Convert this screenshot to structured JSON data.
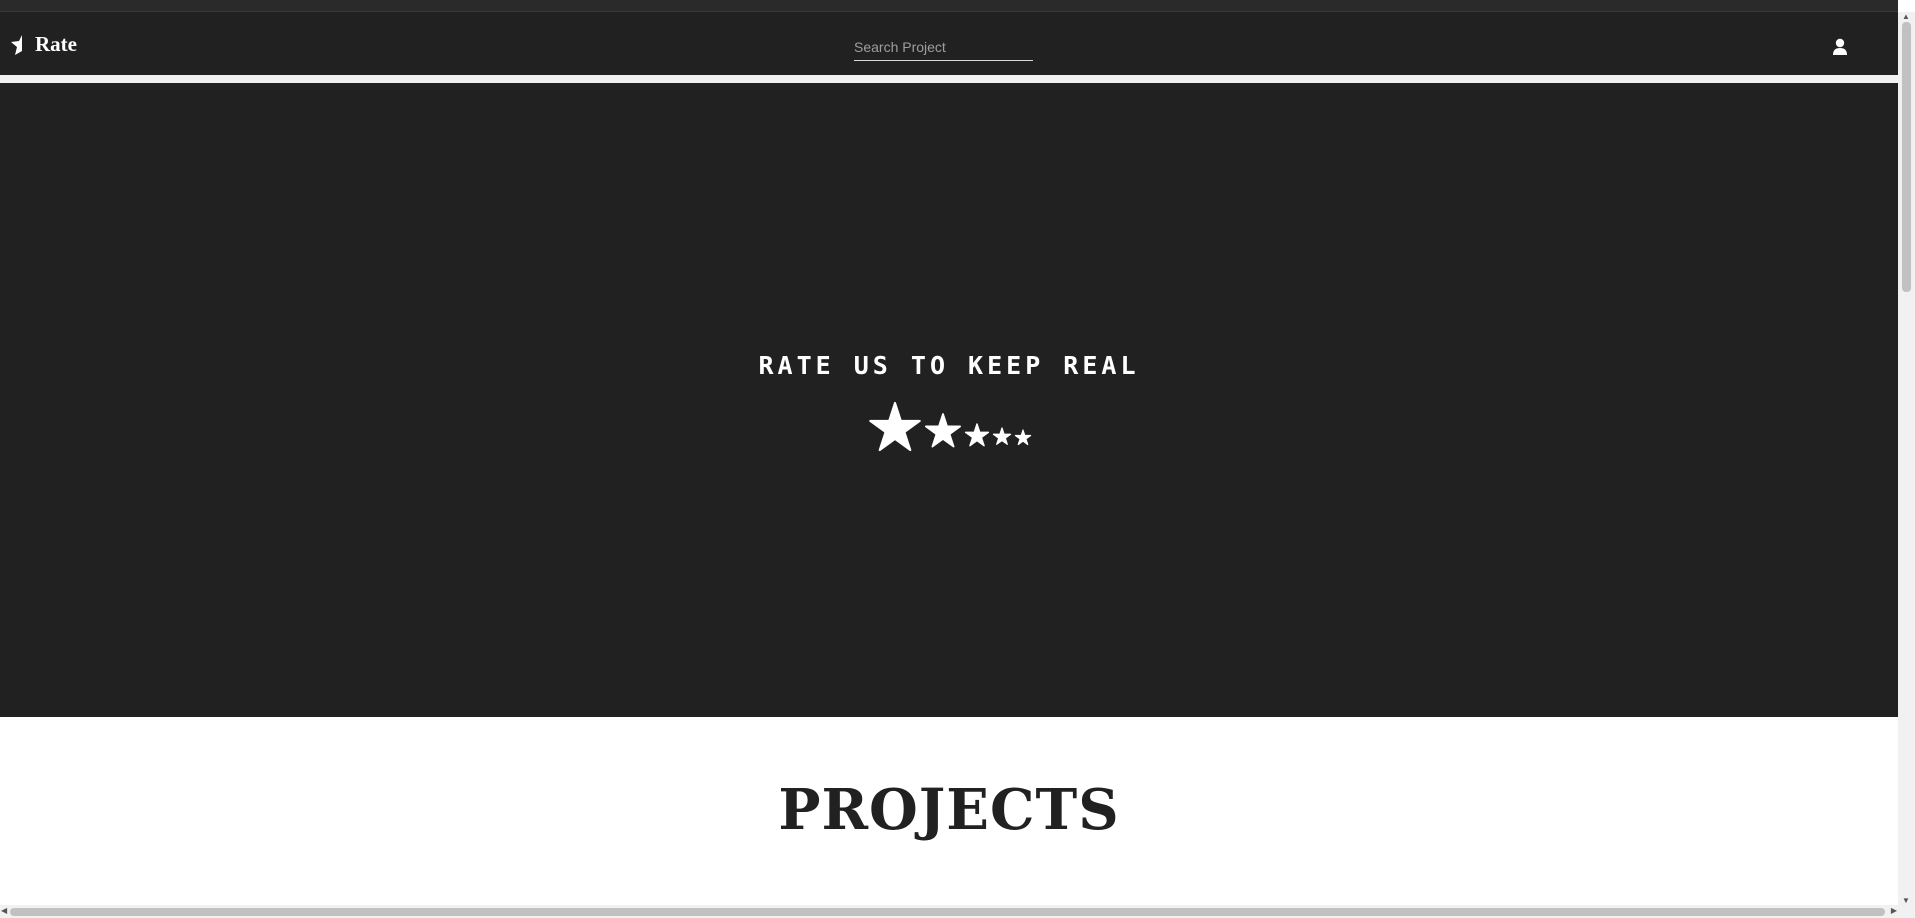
{
  "navbar": {
    "brand_text": "Rate",
    "search_placeholder": "Search Project",
    "user_icon": "user-icon"
  },
  "hero": {
    "title": "RATE US TO KEEP REAL",
    "stars_icon": "star-icon",
    "background_color": "#212121",
    "text_color": "#ffffff"
  },
  "projects": {
    "title": "PROJECTS"
  }
}
